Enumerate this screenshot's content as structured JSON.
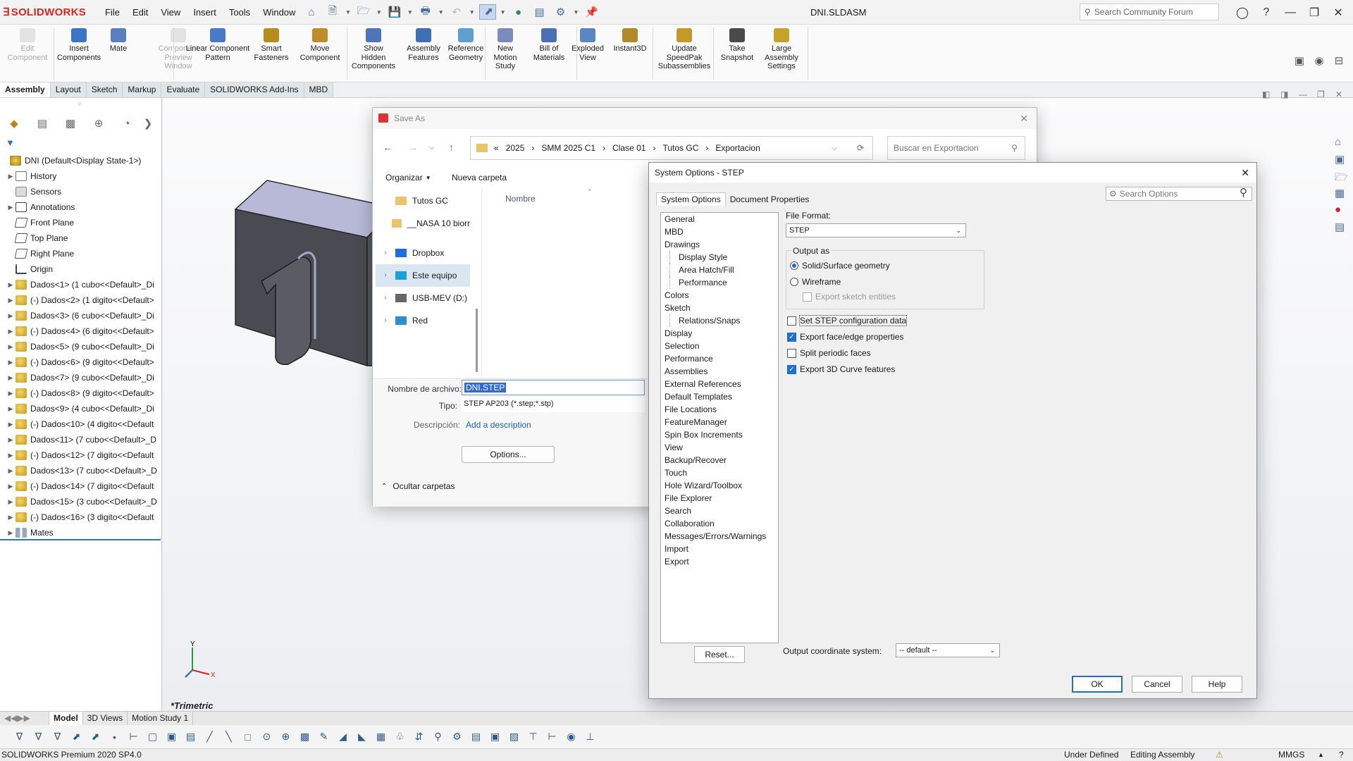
{
  "app": {
    "name": "SOLIDWORKS",
    "doc_title": "DNI.SLDASM",
    "search_placeholder": "Search Community Forum"
  },
  "menu": [
    "File",
    "Edit",
    "View",
    "Insert",
    "Tools",
    "Window"
  ],
  "command_manager": [
    {
      "label": "Edit\nComponent",
      "enabled": false
    },
    {
      "label": "Insert\nComponents",
      "enabled": true
    },
    {
      "label": "Mate",
      "enabled": true
    },
    {
      "label": "Component\nPreview\nWindow",
      "enabled": false
    },
    {
      "label": "Linear Component\nPattern",
      "enabled": true
    },
    {
      "label": "Smart\nFasteners",
      "enabled": true
    },
    {
      "label": "Move\nComponent",
      "enabled": true
    },
    {
      "label": "Show\nHidden\nComponents",
      "enabled": true
    },
    {
      "label": "Assembly\nFeatures",
      "enabled": true
    },
    {
      "label": "Reference\nGeometry",
      "enabled": true
    },
    {
      "label": "New\nMotion\nStudy",
      "enabled": true
    },
    {
      "label": "Bill of\nMaterials",
      "enabled": true
    },
    {
      "label": "Exploded\nView",
      "enabled": true
    },
    {
      "label": "Instant3D",
      "enabled": true
    },
    {
      "label": "Update\nSpeedPak\nSubassemblies",
      "enabled": true
    },
    {
      "label": "Take\nSnapshot",
      "enabled": true
    },
    {
      "label": "Large\nAssembly\nSettings",
      "enabled": true
    }
  ],
  "tabs": [
    "Assembly",
    "Layout",
    "Sketch",
    "Markup",
    "Evaluate",
    "SOLIDWORKS Add-Ins",
    "MBD"
  ],
  "tree": [
    {
      "label": "DNI  (Default<Display State-1>)",
      "icon": "root",
      "expand": false,
      "indent": 0
    },
    {
      "label": "History",
      "icon": "hist",
      "expand": true,
      "indent": 1
    },
    {
      "label": "Sensors",
      "icon": "sens",
      "expand": false,
      "indent": 1
    },
    {
      "label": "Annotations",
      "icon": "annot",
      "expand": true,
      "indent": 1
    },
    {
      "label": "Front Plane",
      "icon": "plane",
      "expand": false,
      "indent": 1
    },
    {
      "label": "Top Plane",
      "icon": "plane",
      "expand": false,
      "indent": 1
    },
    {
      "label": "Right Plane",
      "icon": "plane",
      "expand": false,
      "indent": 1
    },
    {
      "label": "Origin",
      "icon": "orig",
      "expand": false,
      "indent": 1
    },
    {
      "label": "Dados<1> (1 cubo<<Default>_Di",
      "icon": "comp",
      "expand": true,
      "indent": 1
    },
    {
      "label": "(-) Dados<2> (1 digito<<Default>",
      "icon": "comp",
      "expand": true,
      "indent": 1
    },
    {
      "label": "Dados<3> (6 cubo<<Default>_Di",
      "icon": "comp",
      "expand": true,
      "indent": 1
    },
    {
      "label": "(-) Dados<4> (6 digito<<Default>",
      "icon": "comp",
      "expand": true,
      "indent": 1
    },
    {
      "label": "Dados<5> (9 cubo<<Default>_Di",
      "icon": "comp",
      "expand": true,
      "indent": 1
    },
    {
      "label": "(-) Dados<6> (9 digito<<Default>",
      "icon": "comp",
      "expand": true,
      "indent": 1
    },
    {
      "label": "Dados<7> (9 cubo<<Default>_Di",
      "icon": "comp",
      "expand": true,
      "indent": 1
    },
    {
      "label": "(-) Dados<8> (9 digito<<Default>",
      "icon": "comp",
      "expand": true,
      "indent": 1
    },
    {
      "label": "Dados<9> (4 cubo<<Default>_Di",
      "icon": "comp",
      "expand": true,
      "indent": 1
    },
    {
      "label": "(-) Dados<10> (4 digito<<Default",
      "icon": "comp",
      "expand": true,
      "indent": 1
    },
    {
      "label": "Dados<11> (7 cubo<<Default>_D",
      "icon": "comp",
      "expand": true,
      "indent": 1
    },
    {
      "label": "(-) Dados<12> (7 digito<<Default",
      "icon": "comp",
      "expand": true,
      "indent": 1
    },
    {
      "label": "Dados<13> (7 cubo<<Default>_D",
      "icon": "comp",
      "expand": true,
      "indent": 1
    },
    {
      "label": "(-) Dados<14> (7 digito<<Default",
      "icon": "comp",
      "expand": true,
      "indent": 1
    },
    {
      "label": "Dados<15> (3 cubo<<Default>_D",
      "icon": "comp",
      "expand": true,
      "indent": 1
    },
    {
      "label": "(-) Dados<16> (3 digito<<Default",
      "icon": "comp",
      "expand": true,
      "indent": 1
    },
    {
      "label": "Mates",
      "icon": "mates",
      "expand": true,
      "indent": 1
    }
  ],
  "graphics": {
    "view_label": "*Trimetric",
    "axes": {
      "y": "Y",
      "x": "X"
    }
  },
  "bottom_tabs": [
    "Model",
    "3D Views",
    "Motion Study 1"
  ],
  "status": {
    "edition": "SOLIDWORKS Premium 2020 SP4.0",
    "state": "Under Defined",
    "mode": "Editing Assembly",
    "units": "MMGS"
  },
  "save_as": {
    "title": "Save As",
    "breadcrumb": [
      "«",
      "2025",
      "SMM 2025 C1",
      "Clase 01",
      "Tutos GC",
      "Exportacion"
    ],
    "search_placeholder": "Buscar en Exportacion",
    "organize": "Organizar",
    "new_folder": "Nueva carpeta",
    "column_name": "Nombre",
    "nav": [
      {
        "label": "Tutos GC",
        "icon": "folder",
        "expand": false
      },
      {
        "label": "__NASA 10 biorr",
        "icon": "folder",
        "expand": false
      },
      {
        "label": "Dropbox",
        "icon": "dropbox",
        "expand": true
      },
      {
        "label": "Este equipo",
        "icon": "pc",
        "expand": true
      },
      {
        "label": "USB-MEV (D:)",
        "icon": "drive",
        "expand": true
      },
      {
        "label": "Red",
        "icon": "network",
        "expand": true
      }
    ],
    "filename_label": "Nombre de archivo:",
    "filename": "DNI.STEP",
    "type_label": "Tipo:",
    "type": "STEP AP203 (*.step;*.stp)",
    "desc_label": "Descripción:",
    "desc_link": "Add a description",
    "options_button": "Options...",
    "hide_folders": "Ocultar carpetas"
  },
  "system_options": {
    "title": "System Options - STEP",
    "tabs": [
      "System Options",
      "Document Properties"
    ],
    "search_placeholder": "Search Options",
    "categories": [
      {
        "label": "General",
        "sub": false
      },
      {
        "label": "MBD",
        "sub": false
      },
      {
        "label": "Drawings",
        "sub": false
      },
      {
        "label": "Display Style",
        "sub": true
      },
      {
        "label": "Area Hatch/Fill",
        "sub": true
      },
      {
        "label": "Performance",
        "sub": true
      },
      {
        "label": "Colors",
        "sub": false
      },
      {
        "label": "Sketch",
        "sub": false
      },
      {
        "label": "Relations/Snaps",
        "sub": true
      },
      {
        "label": "Display",
        "sub": false
      },
      {
        "label": "Selection",
        "sub": false
      },
      {
        "label": "Performance",
        "sub": false
      },
      {
        "label": "Assemblies",
        "sub": false
      },
      {
        "label": "External References",
        "sub": false
      },
      {
        "label": "Default Templates",
        "sub": false
      },
      {
        "label": "File Locations",
        "sub": false
      },
      {
        "label": "FeatureManager",
        "sub": false
      },
      {
        "label": "Spin Box Increments",
        "sub": false
      },
      {
        "label": "View",
        "sub": false
      },
      {
        "label": "Backup/Recover",
        "sub": false
      },
      {
        "label": "Touch",
        "sub": false
      },
      {
        "label": "Hole Wizard/Toolbox",
        "sub": false
      },
      {
        "label": "File Explorer",
        "sub": false
      },
      {
        "label": "Search",
        "sub": false
      },
      {
        "label": "Collaboration",
        "sub": false
      },
      {
        "label": "Messages/Errors/Warnings",
        "sub": false
      },
      {
        "label": "Import",
        "sub": false
      },
      {
        "label": "Export",
        "sub": false
      }
    ],
    "file_format_label": "File Format:",
    "file_format": "STEP",
    "output_as_label": "Output as",
    "radio_solid": "Solid/Surface geometry",
    "radio_wire": "Wireframe",
    "export_sketch": "Export sketch entities",
    "checks": [
      {
        "label": "Set STEP configuration data",
        "checked": false
      },
      {
        "label": "Export face/edge properties",
        "checked": true
      },
      {
        "label": "Split periodic faces",
        "checked": false
      },
      {
        "label": "Export 3D Curve features",
        "checked": true
      }
    ],
    "reset": "Reset...",
    "coord_label": "Output coordinate system:",
    "coord_value": "-- default --",
    "ok": "OK",
    "cancel": "Cancel",
    "help": "Help"
  },
  "colors": {
    "accent": "#1f6fd0",
    "brand": "#d9261c",
    "tree_line": "#2a79c9"
  }
}
